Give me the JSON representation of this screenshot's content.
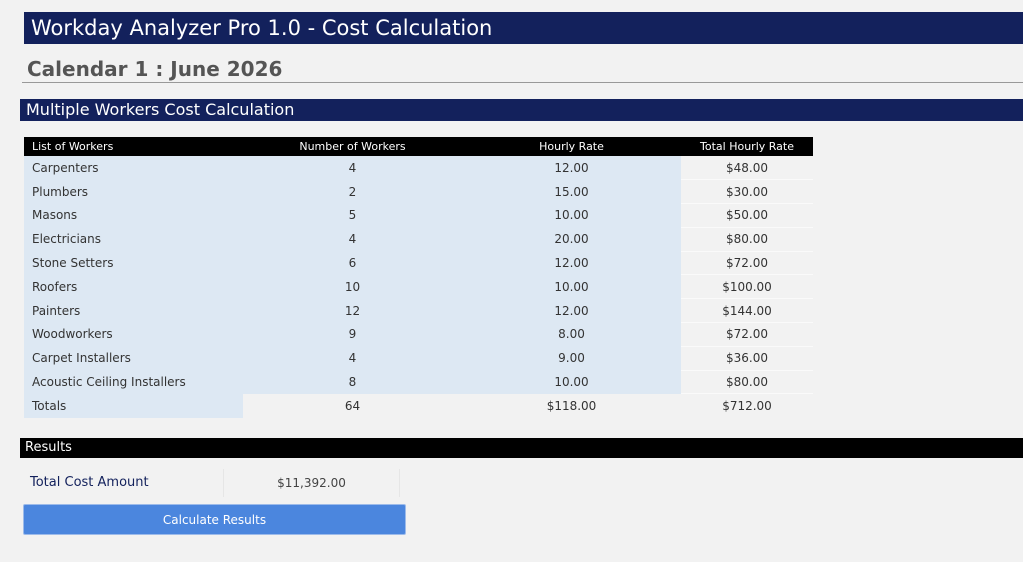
{
  "app": {
    "title": "Workday Analyzer Pro 1.0 - Cost Calculation"
  },
  "calendar": {
    "title": "Calendar 1 : June 2026"
  },
  "section": {
    "title": "Multiple Workers Cost Calculation"
  },
  "table": {
    "headers": [
      "List of Workers",
      "Number of Workers",
      "Hourly Rate",
      "Total Hourly Rate"
    ],
    "rows": [
      {
        "name": "Carpenters",
        "count": "4",
        "rate": "12.00",
        "total": "$48.00"
      },
      {
        "name": "Plumbers",
        "count": "2",
        "rate": "15.00",
        "total": "$30.00"
      },
      {
        "name": "Masons",
        "count": "5",
        "rate": "10.00",
        "total": "$50.00"
      },
      {
        "name": "Electricians",
        "count": "4",
        "rate": "20.00",
        "total": "$80.00"
      },
      {
        "name": "Stone Setters",
        "count": "6",
        "rate": "12.00",
        "total": "$72.00"
      },
      {
        "name": "Roofers",
        "count": "10",
        "rate": "10.00",
        "total": "$100.00"
      },
      {
        "name": "Painters",
        "count": "12",
        "rate": "12.00",
        "total": "$144.00"
      },
      {
        "name": "Woodworkers",
        "count": "9",
        "rate": "8.00",
        "total": "$72.00"
      },
      {
        "name": "Carpet Installers",
        "count": "4",
        "rate": "9.00",
        "total": "$36.00"
      },
      {
        "name": "Acoustic Ceiling Installers",
        "count": "8",
        "rate": "10.00",
        "total": "$80.00"
      }
    ],
    "totals": {
      "label": "Totals",
      "count": "64",
      "rate": "$118.00",
      "total": "$712.00"
    }
  },
  "results": {
    "title": "Results",
    "cost_label": "Total Cost Amount",
    "cost_value": "$11,392.00",
    "button_label": "Calculate Results"
  }
}
